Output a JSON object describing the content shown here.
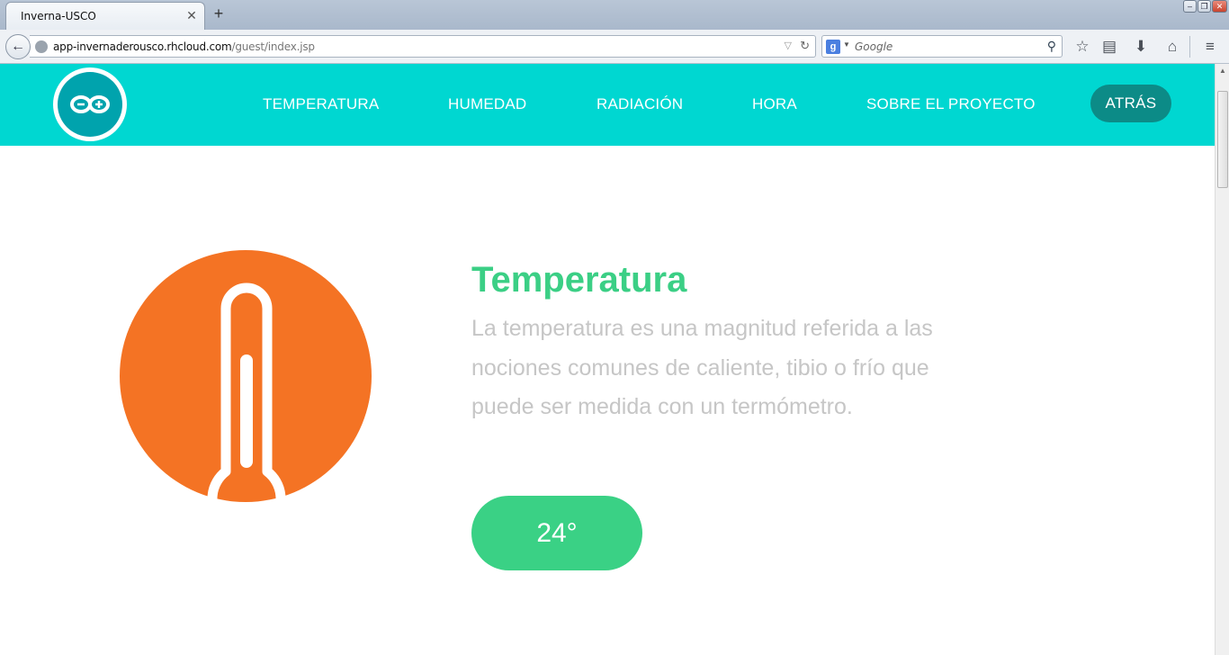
{
  "browser": {
    "tab_title": "Inverna-USCO",
    "tab_close": "✕",
    "new_tab": "+",
    "url_host": "app-invernaderousco.rhcloud.com",
    "url_path": "/guest/index.jsp",
    "search_placeholder": "Google",
    "search_engine_badge": "g",
    "back_glyph": "←",
    "reload_glyph": "↻",
    "dropdown_glyph": "▽"
  },
  "site": {
    "nav": [
      "TEMPERATURA",
      "HUMEDAD",
      "RADIACIÓN",
      "HORA",
      "SOBRE EL PROYECTO"
    ],
    "back_label": "ATRÁS"
  },
  "section": {
    "title": "Temperatura",
    "description": "La temperatura es una magnitud referida a las nociones comunes de caliente, tibio o frío que puede ser medida con un termómetro.",
    "value": "24°"
  },
  "colors": {
    "header": "#00d7d1",
    "accent_green": "#3bcf85",
    "thermometer_circle": "#f47324",
    "back_button": "#0c8b87",
    "description_text": "#c6c6c6"
  },
  "icons": {
    "logo": "arduino-infinity-icon",
    "thermometer": "thermometer-icon",
    "bookmark": "star-icon",
    "reading_list": "clipboard-icon",
    "downloads": "download-arrow-icon",
    "home": "home-icon",
    "menu": "hamburger-menu-icon"
  }
}
